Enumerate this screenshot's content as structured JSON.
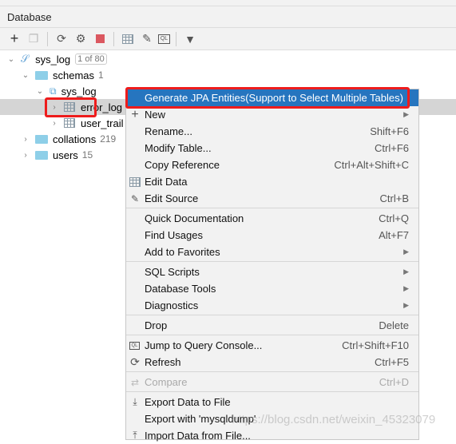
{
  "header": {
    "title": "Database"
  },
  "toolbar": [
    "plus-icon",
    "copy-icon",
    "refresh-icon",
    "settings-icon",
    "stop-icon",
    "table-icon",
    "edit-icon",
    "query-console-icon",
    "filter-icon"
  ],
  "tree": {
    "root": {
      "label": "sys_log",
      "badge": "1 of 80"
    },
    "schemas": {
      "label": "schemas",
      "count": "1"
    },
    "schema": {
      "label": "sys_log"
    },
    "tables": [
      {
        "label": "error_log"
      },
      {
        "label": "user_trail"
      }
    ],
    "collations": {
      "label": "collations",
      "count": "219"
    },
    "users": {
      "label": "users",
      "count": "15"
    }
  },
  "menu": {
    "items": [
      {
        "label": "Generate JPA Entities(Support to Select Multiple Tables)",
        "shortcut": ""
      },
      {
        "label": "New",
        "shortcut": ""
      },
      {
        "label": "Rename...",
        "shortcut": "Shift+F6"
      },
      {
        "label": "Modify Table...",
        "shortcut": "Ctrl+F6"
      },
      {
        "label": "Copy Reference",
        "shortcut": "Ctrl+Alt+Shift+C"
      },
      {
        "label": "Edit Data",
        "shortcut": ""
      },
      {
        "label": "Edit Source",
        "shortcut": "Ctrl+B"
      },
      {
        "label": "Quick Documentation",
        "shortcut": "Ctrl+Q"
      },
      {
        "label": "Find Usages",
        "shortcut": "Alt+F7"
      },
      {
        "label": "Add to Favorites",
        "shortcut": ""
      },
      {
        "label": "SQL Scripts",
        "shortcut": ""
      },
      {
        "label": "Database Tools",
        "shortcut": ""
      },
      {
        "label": "Diagnostics",
        "shortcut": ""
      },
      {
        "label": "Drop",
        "shortcut": "Delete"
      },
      {
        "label": "Jump to Query Console...",
        "shortcut": "Ctrl+Shift+F10"
      },
      {
        "label": "Refresh",
        "shortcut": "Ctrl+F5"
      },
      {
        "label": "Compare",
        "shortcut": "Ctrl+D"
      },
      {
        "label": "Export Data to File",
        "shortcut": ""
      },
      {
        "label": "Export with 'mysqldump'",
        "shortcut": ""
      },
      {
        "label": "Import Data from File...",
        "shortcut": ""
      }
    ]
  },
  "watermark": "https://blog.csdn.net/weixin_45323079",
  "colors": {
    "highlight": "#2675bf",
    "annotation": "#ee1c1c"
  }
}
